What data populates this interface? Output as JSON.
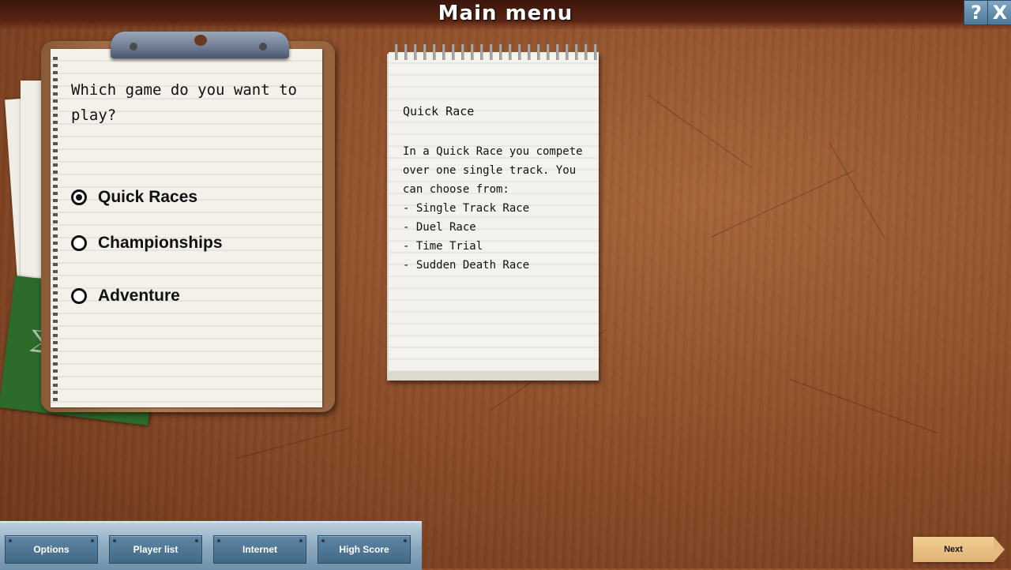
{
  "window": {
    "title": "Main menu",
    "help_label": "?",
    "close_label": "X"
  },
  "clipboard": {
    "question": "Which game do you want to play?",
    "options": [
      {
        "label": "Quick Races",
        "selected": true
      },
      {
        "label": "Championships",
        "selected": false
      },
      {
        "label": "Adventure",
        "selected": false
      }
    ]
  },
  "notepad": {
    "title": "Quick Race",
    "body": "In a Quick Race you compete over one single track. You can choose from:",
    "items": [
      "- Single Track Race",
      "- Duel Race",
      "- Time Trial",
      "- Sudden Death Race"
    ]
  },
  "toolbar": {
    "options_label": "Options",
    "player_list_label": "Player list",
    "internet_label": "Internet",
    "high_score_label": "High Score"
  },
  "next_label": "Next",
  "colors": {
    "wood": "#8e4f2a",
    "toolbar": "#8aa9c0",
    "button": "#4f7898",
    "next": "#e8bd80"
  }
}
